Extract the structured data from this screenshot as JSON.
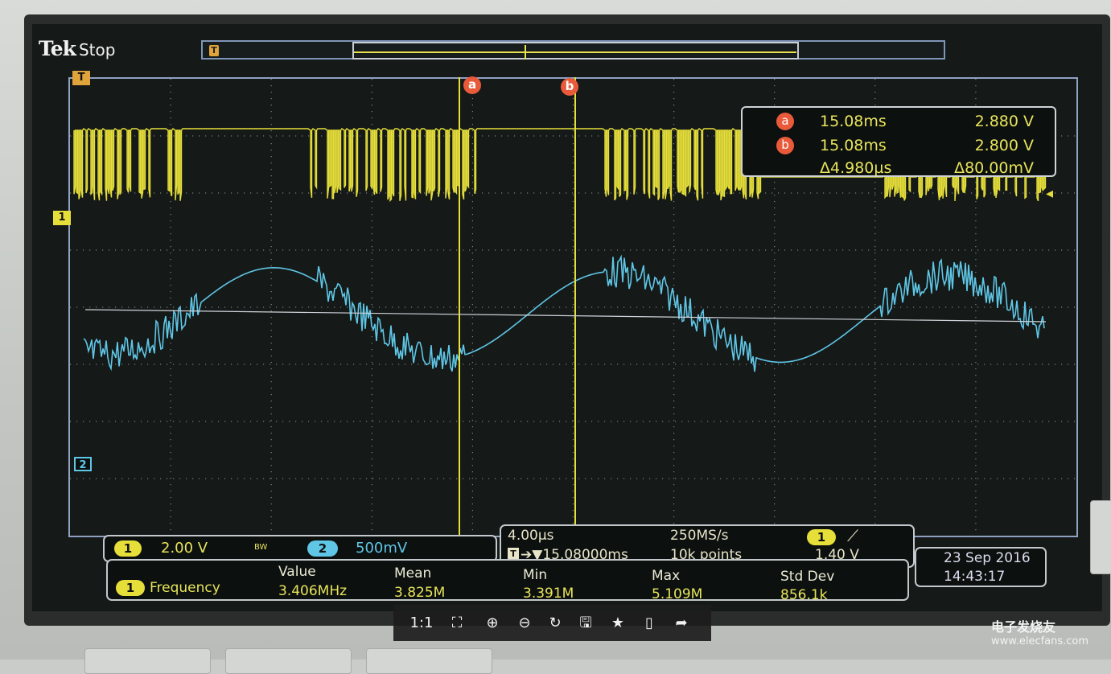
{
  "brand": {
    "name": "Tek",
    "status": "Stop"
  },
  "record_bar": {
    "trigger_marker": "T"
  },
  "screen_markers": {
    "trigger_top": "T",
    "ch1_ground": "1",
    "ch2_ground": "2",
    "cursor_a": "a",
    "cursor_b": "b"
  },
  "cursor_readout": {
    "rows": [
      {
        "label": "a",
        "time": "15.08ms",
        "value": "2.880 V"
      },
      {
        "label": "b",
        "time": "15.08ms",
        "value": "2.800 V"
      },
      {
        "label": "",
        "time": "Δ4.980µs",
        "value": "Δ80.00mV"
      }
    ]
  },
  "channels": {
    "ch1": {
      "number": "1",
      "scale": "2.00 V",
      "bw": "BW",
      "color": "#e6df3a"
    },
    "ch2": {
      "number": "2",
      "scale": "500mV",
      "color": "#5fc6e6"
    }
  },
  "timebase": {
    "scale": "4.00µs",
    "trigger_marker": "T",
    "position": "➔▼15.08000ms",
    "sample_rate": "250MS/s",
    "record_length": "10k points",
    "trigger_channel": "1",
    "trigger_level": "1.40 V"
  },
  "date": {
    "day": "23 Sep  2016",
    "time": "14:43:17"
  },
  "measurement": {
    "channel": "1",
    "name": "Frequency",
    "headers": [
      "Value",
      "Mean",
      "Min",
      "Max",
      "Std Dev"
    ],
    "values": [
      "3.406MHz",
      "3.825M",
      "3.391M",
      "5.109M",
      "856.1k"
    ]
  },
  "viewer_toolbar": {
    "buttons": [
      {
        "name": "actual-size",
        "label": "1:1"
      },
      {
        "name": "fit-screen",
        "label": "⛶"
      },
      {
        "name": "zoom-in",
        "label": "⊕"
      },
      {
        "name": "zoom-out",
        "label": "⊖"
      },
      {
        "name": "rotate",
        "label": "↻"
      },
      {
        "name": "save",
        "label": "🖫"
      },
      {
        "name": "favorite",
        "label": "★"
      },
      {
        "name": "phone",
        "label": "▯"
      },
      {
        "name": "share",
        "label": "➦"
      }
    ]
  },
  "watermark": {
    "text": "电子发烧友",
    "url": "www.elecfans.com"
  }
}
